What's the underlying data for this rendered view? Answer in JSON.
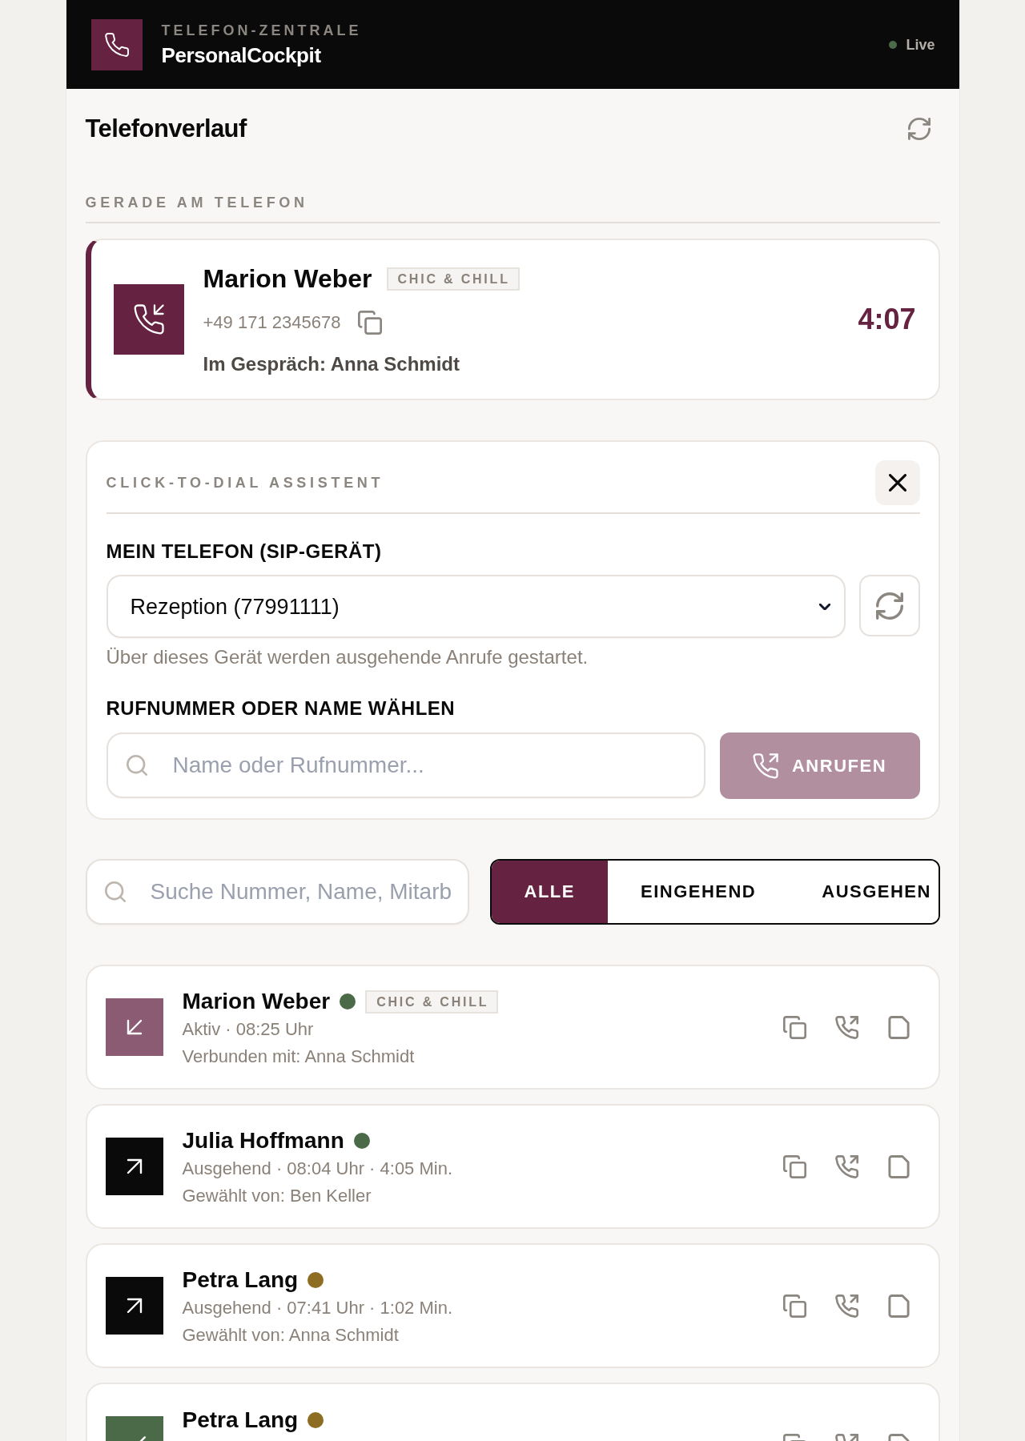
{
  "header": {
    "overline": "TELEFON-ZENTRALE",
    "title": "PersonalCockpit",
    "status": "Live"
  },
  "page": {
    "title": "Telefonverlauf"
  },
  "current": {
    "heading": "GERADE AM TELEFON",
    "calls": [
      {
        "name": "Marion Weber",
        "tag": "CHIC & CHILL",
        "phone": "+49 171 2345678",
        "detail": "Im Gespräch: Anna Schmidt",
        "duration": "4:07"
      }
    ]
  },
  "dialer": {
    "title": "CLICK-TO-DIAL ASSISTENT",
    "device": {
      "label": "MEIN TELEFON (SIP-GERÄT)",
      "value": "Rezeption (77991111)",
      "hint": "Über dieses Gerät werden ausgehende Anrufe gestartet."
    },
    "target": {
      "label": "RUFNUMMER ODER NAME WÄHLEN",
      "placeholder": "Name oder Rufnummer..."
    },
    "call_button": {
      "label": "ANRUFEN",
      "disabled": true
    }
  },
  "filters": {
    "search": {
      "placeholder": "Suche Nummer, Name, Mitarb"
    },
    "tabs": [
      {
        "label": "ALLE",
        "selected": true
      },
      {
        "label": "EINGEHEND",
        "selected": false
      },
      {
        "label": "AUSGEHEN",
        "selected": false
      }
    ]
  },
  "calls": [
    {
      "kind": "active",
      "name": "Marion Weber",
      "color": "#4b6b48",
      "tag": "CHIC & CHILL",
      "meta": "Aktiv · 08:25 Uhr",
      "detail": "Verbunden mit: Anna Schmidt"
    },
    {
      "kind": "outgoing",
      "name": "Julia Hoffmann",
      "color": "#4b6b48",
      "meta": "Ausgehend · 08:04 Uhr · 4:05 Min.",
      "detail": "Gewählt von: Ben Keller"
    },
    {
      "kind": "outgoing",
      "name": "Petra Lang",
      "color": "#8c6d22",
      "meta": "Ausgehend · 07:41 Uhr · 1:02 Min.",
      "detail": "Gewählt von: Anna Schmidt"
    },
    {
      "kind": "callback",
      "name": "Petra Lang",
      "color": "#8c6d22"
    }
  ]
}
